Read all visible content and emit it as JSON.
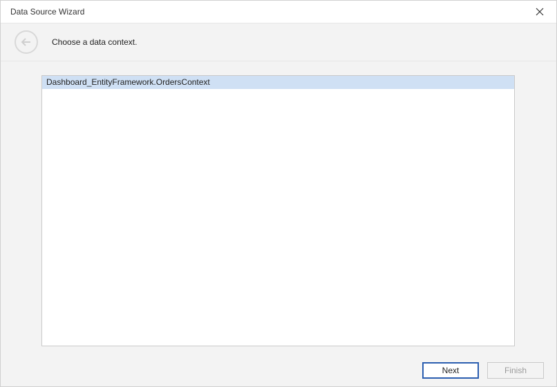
{
  "titlebar": {
    "title": "Data Source Wizard"
  },
  "header": {
    "instruction": "Choose a data context."
  },
  "list": {
    "items": [
      {
        "label": "Dashboard_EntityFramework.OrdersContext",
        "selected": true
      }
    ]
  },
  "footer": {
    "next_label": "Next",
    "finish_label": "Finish"
  }
}
